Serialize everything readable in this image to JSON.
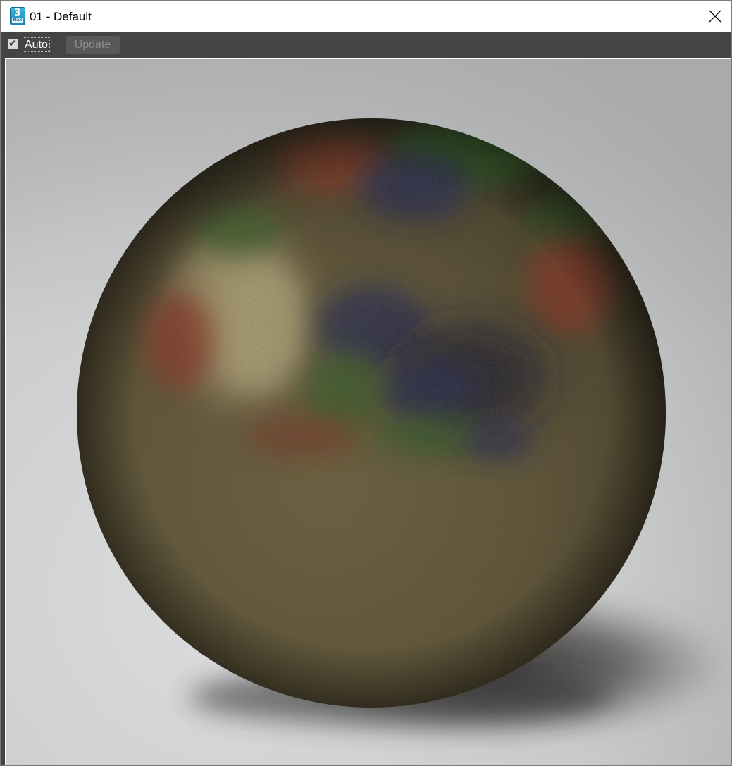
{
  "window": {
    "title": "01 - Default",
    "icon": {
      "name": "3ds-max-icon",
      "glyph": "3",
      "sub": "MAX"
    }
  },
  "titlebar": {
    "close_icon": "close-icon"
  },
  "toolbar": {
    "auto": {
      "label": "Auto",
      "checked": true,
      "tick": "✔"
    },
    "update": {
      "label": "Update",
      "enabled": false
    }
  },
  "preview": {
    "subject": "material-preview-sphere",
    "colors": {
      "background": "#c9cbcd",
      "sphere_base": "#5c5234",
      "reflection_red": "#8a2a1e",
      "reflection_green": "#2b5a24",
      "reflection_blue": "#1e2350",
      "highlight": "#a89a70"
    }
  }
}
